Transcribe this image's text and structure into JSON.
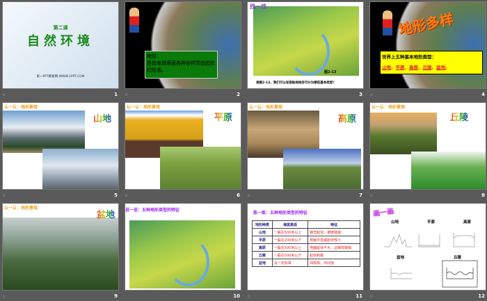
{
  "slides": [
    {
      "number": "1",
      "subtitle": "第二课",
      "title": "自然环境",
      "footer": "第一PPT模板网-WWW.1PPT.COM"
    },
    {
      "number": "2",
      "box_title": "地形：",
      "box_text": "是指地球表面各种各样高低起伏的形态。"
    },
    {
      "number": "3",
      "header": "找一找",
      "figure_label": "图2-13",
      "caption": "读图2-13，我们可以发现陆地地形可分为哪些基本类型？"
    },
    {
      "number": "4",
      "title": "地形多样",
      "box_title": "世界上五种基本地形类型：",
      "types": [
        "山地",
        "平原",
        "高原",
        "丘陵",
        "盆地"
      ]
    },
    {
      "number": "5",
      "header": "认一认：地形景观",
      "tag": "山地"
    },
    {
      "number": "6",
      "header": "认一认：地形景观",
      "tag": "平原"
    },
    {
      "number": "7",
      "header": "认一认：地形景观",
      "tag": "高原"
    },
    {
      "number": "8",
      "header": "认一认：地形景观",
      "tag": "丘陵"
    },
    {
      "number": "9",
      "header": "认一认：地形景观",
      "tag": "盆地"
    },
    {
      "number": "10",
      "header": "说一说：五种地形类型的特征"
    },
    {
      "number": "11",
      "header": "练一练：五种地形类型的特征",
      "columns": [
        "地形种类",
        "海拔高低",
        "特征"
      ],
      "rows": [
        [
          "山地",
          "一般在500米以上",
          "峰峦起伏，坡度陡峻"
        ],
        [
          "平原",
          "一般在200米以下",
          "地面平坦或起伏较小"
        ],
        [
          "高原",
          "一般在500米以上",
          "地面起伏不大，边缘较陡峭"
        ],
        [
          "丘陵",
          "一般在500米以下",
          "起伏和缓"
        ],
        [
          "盆地",
          "没一定标准",
          "四周高，中间低"
        ]
      ]
    },
    {
      "number": "12",
      "header": "画一画",
      "labels": [
        "山地",
        "平原",
        "高原",
        "盆地",
        "丘陵"
      ]
    }
  ],
  "colors": {
    "accent_green": "#1a8a1a",
    "box_green": "#0a7a0a",
    "box_yellow": "#ffff00",
    "header_orange": "#f0a020",
    "header_purple": "#a020f0"
  }
}
